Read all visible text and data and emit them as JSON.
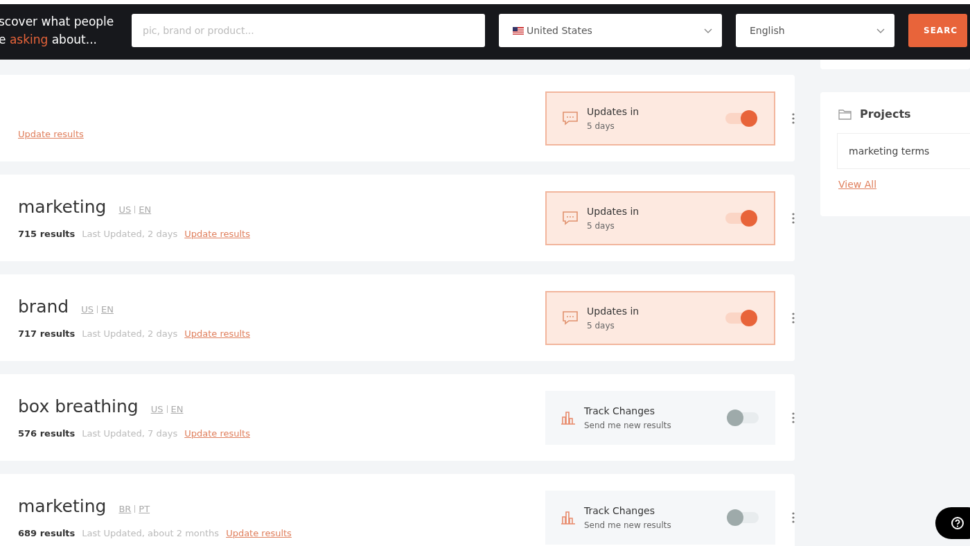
{
  "header": {
    "headline": {
      "line_1": "scover what people",
      "line_2_start": "e ",
      "line_2_highlight": "asking",
      "line_2_end": " about..."
    },
    "search": {
      "placeholder": "pic, brand or product..."
    },
    "country": {
      "value": "United States"
    },
    "language": {
      "value": "English"
    },
    "search_button": "SEARC"
  },
  "searches": [
    {
      "update_link": "Update results",
      "tracking": {
        "kind": "updates",
        "title": "Updates in",
        "subtitle": "5 days",
        "on": true
      }
    },
    {
      "term": "marketing",
      "region": "US",
      "language": "EN",
      "results": "715 results",
      "last_updated": "Last Updated, 2 days",
      "update_link": "Update results",
      "tracking": {
        "kind": "updates",
        "title": "Updates in",
        "subtitle": "5 days",
        "on": true
      }
    },
    {
      "term": "brand",
      "region": "US",
      "language": "EN",
      "results": "717 results",
      "last_updated": "Last Updated, 2 days",
      "update_link": "Update results",
      "tracking": {
        "kind": "updates",
        "title": "Updates in",
        "subtitle": "5 days",
        "on": true
      }
    },
    {
      "term": "box breathing",
      "region": "US",
      "language": "EN",
      "results": "576 results",
      "last_updated": "Last Updated, 7 days",
      "update_link": "Update results",
      "tracking": {
        "kind": "track",
        "title": "Track Changes",
        "subtitle": "Send me new results",
        "on": false
      }
    },
    {
      "term": "marketing",
      "region": "BR",
      "language": "PT",
      "results": "689 results",
      "last_updated": "Last Updated, about 2 months",
      "update_link": "Update results",
      "tracking": {
        "kind": "track",
        "title": "Track Changes",
        "subtitle": "Send me new results",
        "on": false
      }
    }
  ],
  "projects": {
    "title": "Projects",
    "items": [
      "marketing terms"
    ],
    "view_all": "View All"
  }
}
